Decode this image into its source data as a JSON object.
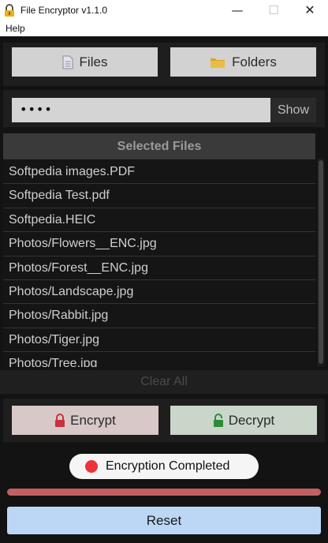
{
  "window": {
    "title": "File Encryptor v1.1.0",
    "minimize": "—",
    "maximize": "☐",
    "close": "✕"
  },
  "menu": {
    "help": "Help"
  },
  "buttons": {
    "files": "Files",
    "folders": "Folders"
  },
  "password": {
    "value": "••••",
    "show": "Show"
  },
  "selected_files": {
    "header": "Selected Files",
    "items": [
      "Softpedia images.PDF",
      "Softpedia Test.pdf",
      "Softpedia.HEIC",
      "Photos/Flowers__ENC.jpg",
      "Photos/Forest__ENC.jpg",
      "Photos/Landscape.jpg",
      "Photos/Rabbit.jpg",
      "Photos/Tiger.jpg",
      "Photos/Tree.jpg"
    ],
    "clear_all": "Clear All"
  },
  "actions": {
    "encrypt": "Encrypt",
    "decrypt": "Decrypt",
    "reset": "Reset"
  },
  "status": {
    "text": "Encryption Completed",
    "progress": 1.0
  },
  "colors": {
    "background": "#131313",
    "status_dot": "#ee3338",
    "progress": "#c06060",
    "reset": "#bcd7f5",
    "lock_red": "#c8323a",
    "lock_green": "#2e8b3a",
    "folder": "#d8a52a"
  },
  "icons": {
    "title": "lock-icon",
    "files": "file-icon",
    "folders": "folder-icon",
    "encrypt": "lock-closed-icon",
    "decrypt": "lock-open-icon"
  }
}
